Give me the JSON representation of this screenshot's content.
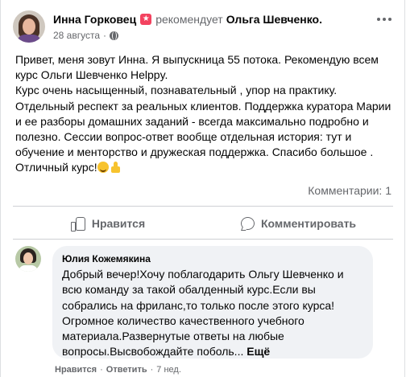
{
  "post": {
    "author": "Инна Горковец",
    "recommend_text": "рекомендует",
    "recommended_page": "Ольга Шевченко.",
    "date": "28 августа",
    "separator": "·",
    "text": "Привет, меня зовут Инна.  Я выпускница 55 потока. Рекомендую всем курс Ольги Шевченко Helppy.\nКурс очень насыщенный, познавательный , упор на практику. Отдельный респект за реальных клиентов. Поддержка куратора Марии  и ее разборы домашних заданий  - всегда максимально подробно и полезно. Сессии вопрос-ответ  вообще отдельная история: тут и обучение и менторство и дружеская поддержка. Спасибо большое . Отличный курс!",
    "comments_count": "Комментарии: 1"
  },
  "actions": {
    "like_label": "Нравится",
    "comment_label": "Комментировать"
  },
  "comment": {
    "author": "Юлия Кожемякина",
    "text": "Добрый вечер!Хочу поблагодарить Ольгу Шевченко и всю команду за такой обалденный курс.Если вы собрались на фриланс,то только после этого курса!\nОгромное количество качественного учебного материала.Развернутые ответы на любые вопросы.Высвобождайте поболь... ",
    "see_more": "Ещё",
    "like_label": "Нравится",
    "reply_label": "Ответить",
    "separator": "·",
    "time": "7 нед."
  },
  "icons": {
    "recommend": "recommend-star-icon",
    "privacy": "globe-icon",
    "menu": "more-options-icon",
    "like": "thumbs-up-icon",
    "comment": "comment-bubble-icon",
    "emoji1": "smiling-face-emoji",
    "emoji2": "thumbs-up-emoji"
  },
  "colors": {
    "text_primary": "#050505",
    "text_secondary": "#65676b",
    "recommend_accent": "#f3425f",
    "bubble_bg": "#f0f2f5",
    "divider": "#ced0d4"
  }
}
